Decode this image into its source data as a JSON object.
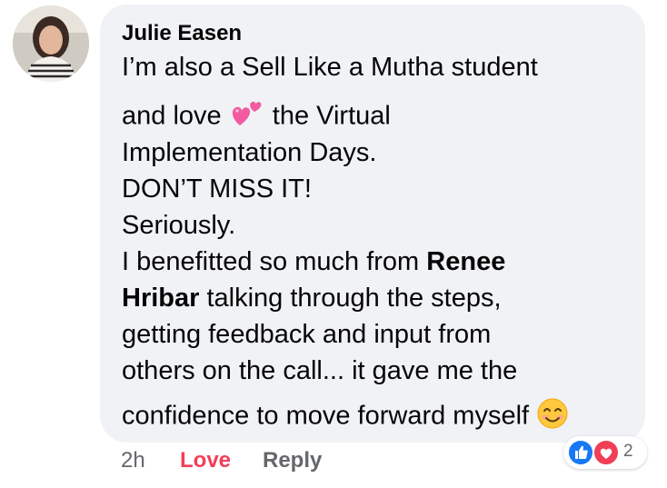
{
  "comment": {
    "author": "Julie Easen",
    "lines": {
      "l1": "I’m also a Sell Like a Mutha student",
      "l2a": "and love",
      "l2b": "the Virtual",
      "l3": "Implementation Days.",
      "l4": "DON’T MISS IT!",
      "l5": "Seriously.",
      "l6a": "I benefitted so much from",
      "l6b": "Renee",
      "l7a": "Hribar",
      "l7b": "talking through the steps,",
      "l8": "getting feedback and input from",
      "l9": "others on the call... it gave me the",
      "l10": "confidence to move forward myself"
    },
    "emojis": [
      "two-hearts-icon",
      "smiling-face-icon"
    ]
  },
  "actions": {
    "time": "2h",
    "love_label": "Love",
    "reply_label": "Reply"
  },
  "reactions": {
    "icons": [
      "like-icon",
      "heart-icon"
    ],
    "count": "2"
  },
  "colors": {
    "bubble": "#f0f2f5",
    "love": "#f33e58",
    "muted": "#65676b",
    "like_blue": "#1877f2",
    "heart_red": "#f33e58"
  }
}
